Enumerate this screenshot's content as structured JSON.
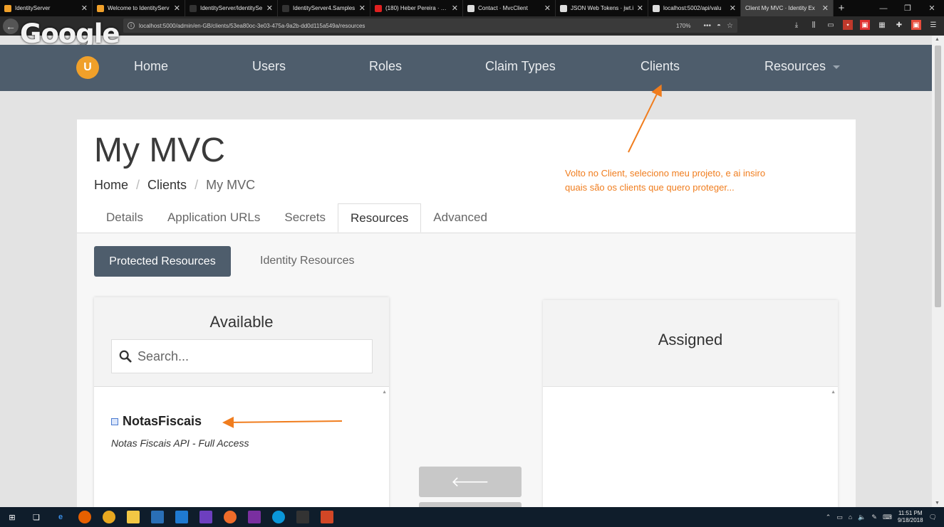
{
  "browser": {
    "tabs": [
      {
        "label": "IdentityServer",
        "color": "#f0a02a",
        "active": false
      },
      {
        "label": "Welcome to IdentityServ",
        "color": "#f0a02a",
        "active": false
      },
      {
        "label": "IdentityServer/IdentitySe",
        "color": "#333333",
        "active": false
      },
      {
        "label": "IdentityServer4.Samples",
        "color": "#333333",
        "active": false
      },
      {
        "label": "(180) Heber Pereira · You",
        "color": "#e02020",
        "active": false
      },
      {
        "label": "Contact · MvcClient",
        "color": "#dddddd",
        "active": false
      },
      {
        "label": "JSON Web Tokens · jwt.i",
        "color": "#dddddd",
        "active": false
      },
      {
        "label": "localhost:5002/api/valu",
        "color": "#dddddd",
        "active": false
      },
      {
        "label": "Client My MVC · Identity Ex",
        "color": "#3d3d3d",
        "active": true
      }
    ],
    "new_tab": "+",
    "url": "localhost:5000/admin/en-GB/clients/53ea80oc-3e03-475a-9a2b-dd0d115a549a/resources",
    "zoom": "170%",
    "overlay_logo": "Google"
  },
  "nav": {
    "brand": "U",
    "items": [
      "Home",
      "Users",
      "Roles",
      "Claim Types",
      "Clients",
      "Resources"
    ]
  },
  "page": {
    "title": "My MVC",
    "breadcrumb": [
      "Home",
      "Clients",
      "My MVC"
    ],
    "tabs": [
      "Details",
      "Application URLs",
      "Secrets",
      "Resources",
      "Advanced"
    ],
    "active_tab": "Resources",
    "subtabs": {
      "active": "Protected Resources",
      "inactive": "Identity Resources"
    },
    "available": {
      "title": "Available",
      "search_placeholder": "Search...",
      "item_name": "NotasFiscais",
      "item_desc": "Notas Fiscais API - Full Access"
    },
    "assigned": {
      "title": "Assigned"
    }
  },
  "annotation": {
    "line1": "Volto no Client, seleciono meu projeto, e ai insiro",
    "line2": "quais são os clients que quero proteger...",
    "color": "#f07d1e"
  },
  "taskbar": {
    "time": "11:51 PM",
    "date": "9/18/2018"
  }
}
